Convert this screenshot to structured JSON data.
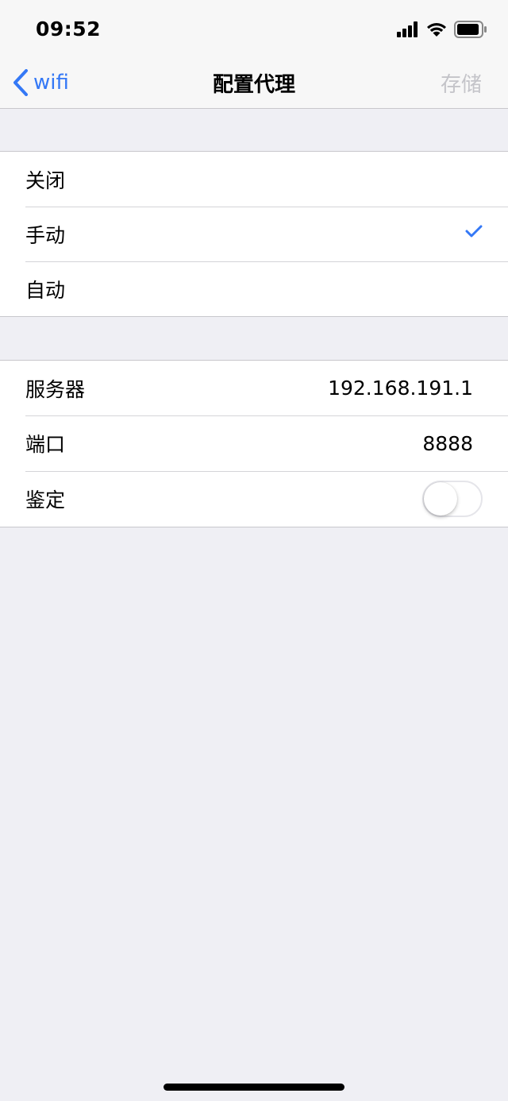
{
  "status_bar": {
    "time": "09:52"
  },
  "nav": {
    "back_label": "wifi",
    "title": "配置代理",
    "save_label": "存储"
  },
  "proxy_modes": [
    {
      "label": "关闭",
      "selected": false
    },
    {
      "label": "手动",
      "selected": true
    },
    {
      "label": "自动",
      "selected": false
    }
  ],
  "settings": {
    "server": {
      "label": "服务器",
      "value": "192.168.191.1"
    },
    "port": {
      "label": "端口",
      "value": "8888"
    },
    "auth": {
      "label": "鉴定",
      "enabled": false
    }
  },
  "colors": {
    "accent": "#3478f6",
    "disabled": "#c4c4c9",
    "background": "#efeff4"
  }
}
